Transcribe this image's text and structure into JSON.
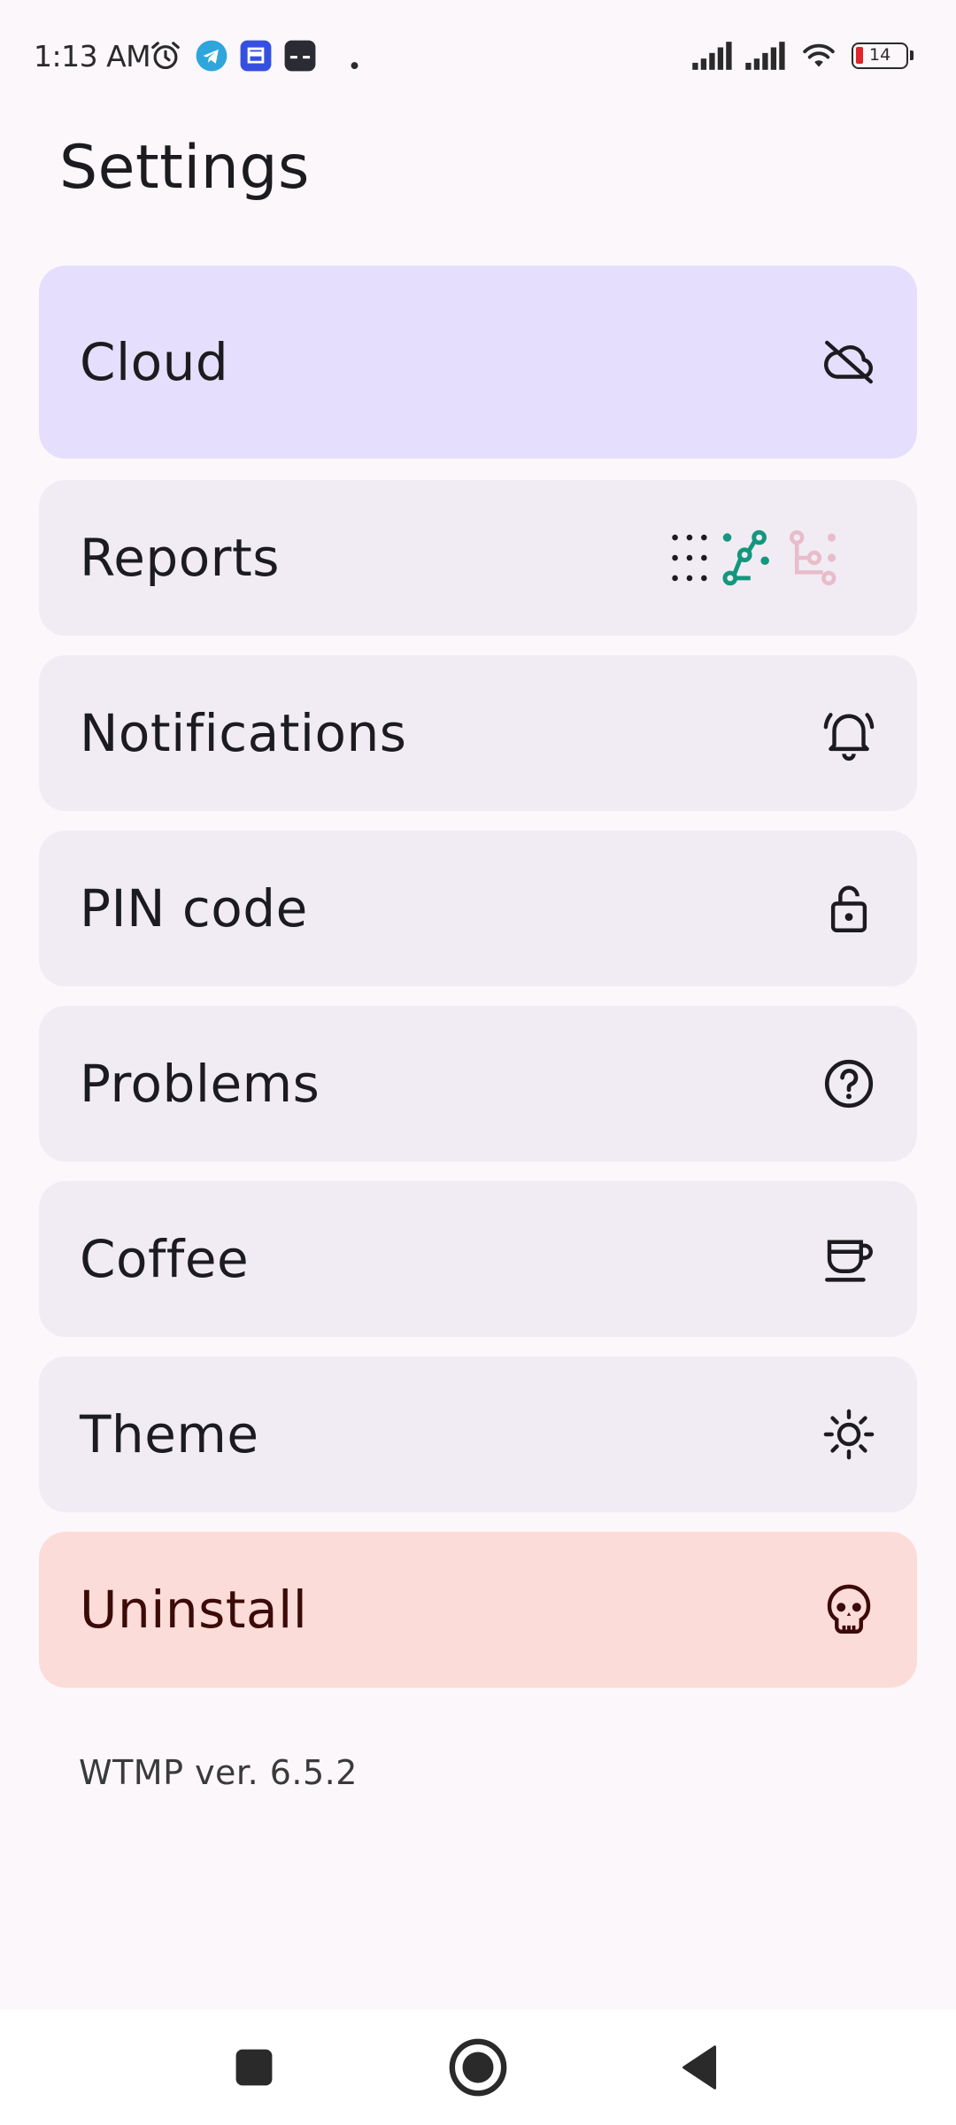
{
  "status_bar": {
    "time": "1:13 AM",
    "battery": "14",
    "icons": [
      "alarm-icon",
      "telegram-icon",
      "app-icon",
      "app-icon-dark",
      "dot-icon",
      "signal-icon",
      "signal-icon",
      "wifi-icon",
      "battery-icon"
    ]
  },
  "header": {
    "title": "Settings"
  },
  "menu": {
    "items": [
      {
        "label": "Cloud",
        "icon": "cloud-off-icon"
      },
      {
        "label": "Reports",
        "icons": [
          "dots-grid-icon",
          "timeline-icon",
          "tree-icon"
        ]
      },
      {
        "label": "Notifications",
        "icon": "bell-ring-icon"
      },
      {
        "label": "PIN code",
        "icon": "lock-open-icon"
      },
      {
        "label": "Problems",
        "icon": "help-circle-icon"
      },
      {
        "label": "Coffee",
        "icon": "coffee-cup-icon"
      },
      {
        "label": "Theme",
        "icon": "sun-icon"
      },
      {
        "label": "Uninstall",
        "icon": "skull-icon"
      }
    ]
  },
  "footer": {
    "version": "WTMP ver. 6.5.2"
  },
  "colors": {
    "background": "#fcf7fb",
    "item_default": "#f1ecf4",
    "item_cloud": "#e5dffd",
    "item_uninstall": "#fcdcd8",
    "uninstall_text": "#3b0a09",
    "teal_accent": "#13977f",
    "pink_accent": "#e9bcc9"
  }
}
